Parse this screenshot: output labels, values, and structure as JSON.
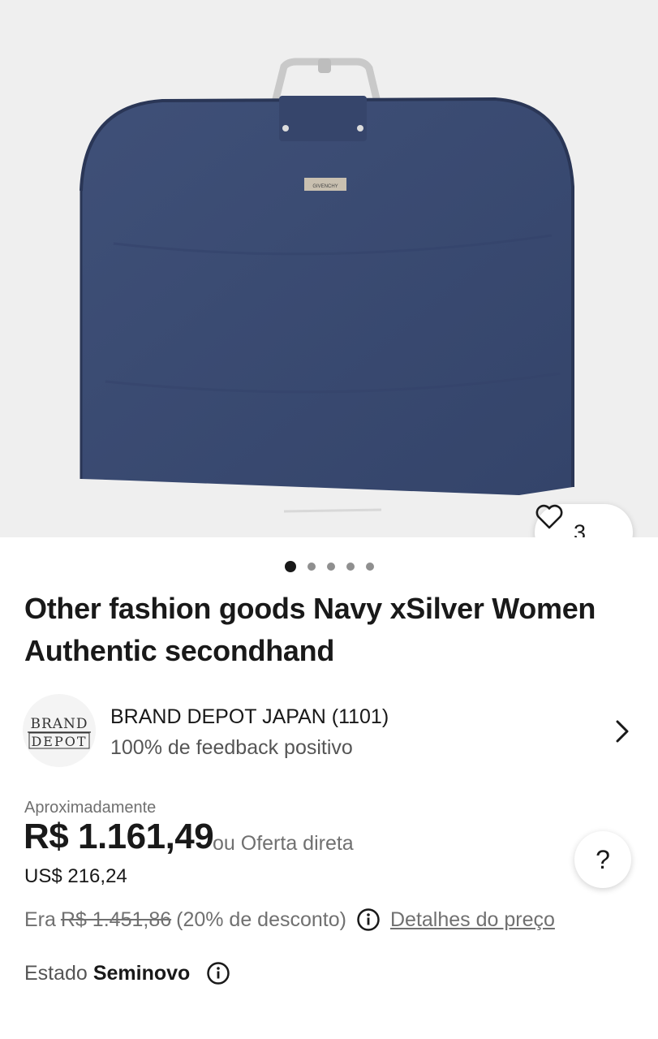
{
  "gallery": {
    "favorite_count": "3",
    "brand_tag": "GIVENCHY",
    "image_count": 5,
    "active_image": 1
  },
  "listing": {
    "title": "Other fashion goods Navy xSilver Women Authentic secondhand"
  },
  "seller": {
    "logo_line1": "BRAND",
    "logo_line2": "DEPOT",
    "name": "BRAND DEPOT JAPAN (1101)",
    "feedback": "100% de feedback positivo"
  },
  "price": {
    "approx_label": "Aproximadamente",
    "value": "R$ 1.161,49",
    "offer": "ou Oferta direta",
    "usd": "US$ 216,24",
    "help": "?",
    "was_label": "Era",
    "was_value": "R$ 1.451,86",
    "discount": "(20% de desconto)",
    "details_link": "Detalhes do preço"
  },
  "condition": {
    "label": "Estado",
    "value": "Seminovo"
  },
  "colors": {
    "bag": "#3c4d73",
    "text": "#191919",
    "muted": "#707070"
  },
  "icons": [
    "heart-icon",
    "chevron-right-icon",
    "help-icon",
    "info-icon"
  ]
}
